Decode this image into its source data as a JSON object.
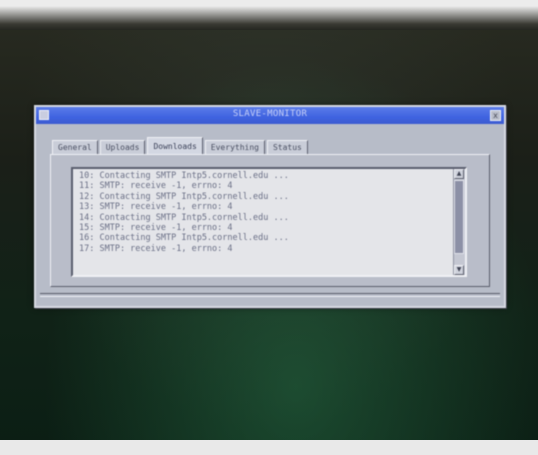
{
  "window": {
    "title": "SLAVE-MONITOR",
    "close_glyph": "x"
  },
  "tabs": [
    {
      "label": "General",
      "active": false
    },
    {
      "label": "Uploads",
      "active": false
    },
    {
      "label": "Downloads",
      "active": true
    },
    {
      "label": "Everything",
      "active": false
    },
    {
      "label": "Status",
      "active": false
    }
  ],
  "log": {
    "lines": [
      "10: Contacting SMTP Intp5.cornell.edu ...",
      "11: SMTP: receive -1, errno: 4",
      "12: Contacting SMTP Intp5.cornell.edu ...",
      "13: SMTP: receive -1, errno: 4",
      "14: Contacting SMTP Intp5.cornell.edu ...",
      "15: SMTP: receive -1, errno: 4",
      "16: Contacting SMTP Intp5.cornell.edu ...",
      "17: SMTP: receive -1, errno: 4"
    ],
    "scroll_up_glyph": "▲",
    "scroll_down_glyph": "▼"
  }
}
